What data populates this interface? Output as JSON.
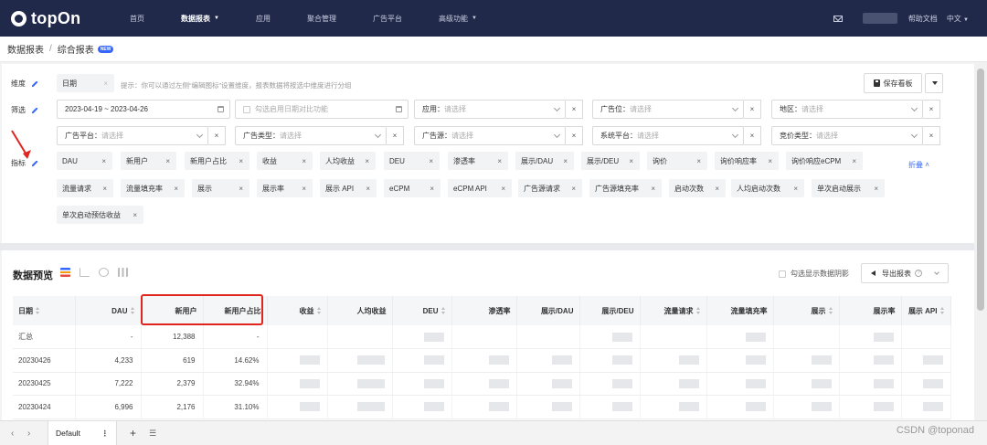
{
  "nav": {
    "brand": "topOn",
    "items": [
      {
        "label": "首页",
        "caret": false,
        "active": false
      },
      {
        "label": "数据报表",
        "caret": true,
        "active": true
      },
      {
        "label": "应用",
        "caret": false,
        "active": false
      },
      {
        "label": "聚合管理",
        "caret": false,
        "active": false
      },
      {
        "label": "广告平台",
        "caret": false,
        "active": false
      },
      {
        "label": "高级功能",
        "caret": true,
        "active": false
      }
    ],
    "help": "帮助文档",
    "lang": "中文"
  },
  "breadcrumb": {
    "parent": "数据报表",
    "separator": "/",
    "current": "综合报表",
    "badge": "NEW"
  },
  "filters": {
    "dimension_label": "维度",
    "dimension_chip": "日期",
    "hint": "提示：你可以通过左侧“编辑图标”设置维度，报表数据将按选中维度进行分组",
    "save_button": "保存看板",
    "filter_label": "筛选",
    "date_range": "2023-04-19 ~ 2023-04-26",
    "compare_label": "勾选启用日期对比功能",
    "selects": [
      {
        "label": "应用：",
        "placeholder": "请选择"
      },
      {
        "label": "广告位：",
        "placeholder": "请选择"
      },
      {
        "label": "地区：",
        "placeholder": "请选择"
      },
      {
        "label": "广告平台：",
        "placeholder": "请选择"
      },
      {
        "label": "广告类型：",
        "placeholder": "请选择"
      },
      {
        "label": "广告源：",
        "placeholder": "请选择"
      },
      {
        "label": "系统平台：",
        "placeholder": "请选择"
      },
      {
        "label": "竞价类型：",
        "placeholder": "请选择"
      }
    ],
    "metric_label": "指标",
    "collapse": "折叠",
    "metrics": [
      "DAU",
      "新用户",
      "新用户占比",
      "收益",
      "人均收益",
      "DEU",
      "渗透率",
      "展示/DAU",
      "展示/DEU",
      "询价",
      "询价响应率",
      "询价响应eCPM",
      "流量请求",
      "流量填充率",
      "展示",
      "展示率",
      "展示 API",
      "eCPM",
      "eCPM API",
      "广告源请求",
      "广告源填充率",
      "启动次数",
      "人均启动次数",
      "单次启动展示",
      "单次启动预估收益"
    ]
  },
  "data_section": {
    "title": "数据预览",
    "compare_checkbox": "勾选显示数据阴影",
    "export_button": "导出报表",
    "columns": [
      "日期",
      "DAU",
      "新用户",
      "新用户占比",
      "收益",
      "人均收益",
      "DEU",
      "渗透率",
      "展示/DAU",
      "展示/DEU",
      "流量请求",
      "流量填充率",
      "展示",
      "展示率",
      "展示 API"
    ],
    "rows": [
      [
        "汇总",
        "-",
        "12,388",
        "-"
      ],
      [
        "20230426",
        "4,233",
        "619",
        "14.62%"
      ],
      [
        "20230425",
        "7,222",
        "2,379",
        "32.94%"
      ],
      [
        "20230424",
        "6,996",
        "2,176",
        "31.10%"
      ]
    ]
  },
  "bottom": {
    "tab": "Default",
    "watermark": "CSDN @toponad"
  }
}
